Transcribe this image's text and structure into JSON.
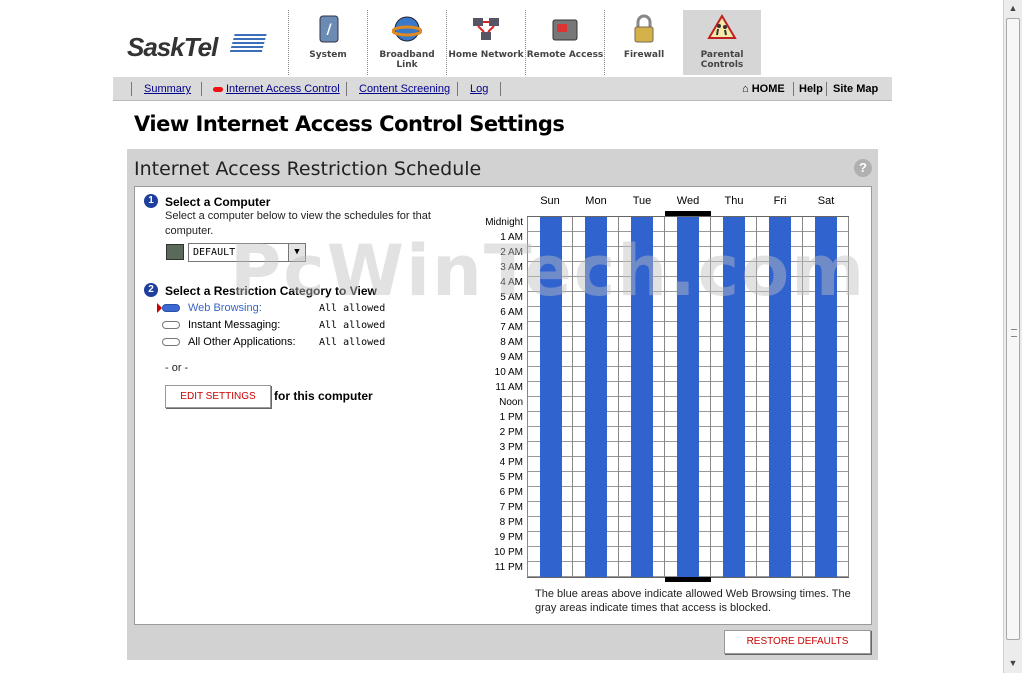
{
  "brand": {
    "logo_text": "SaskTel"
  },
  "nav": [
    {
      "label": "System",
      "icon": "system-icon"
    },
    {
      "label": "Broadband Link",
      "icon": "globe-icon"
    },
    {
      "label": "Home Network",
      "icon": "network-icon"
    },
    {
      "label": "Remote Access",
      "icon": "remote-access-icon"
    },
    {
      "label": "Firewall",
      "icon": "padlock-icon"
    },
    {
      "label": "Parental Controls",
      "icon": "warning-sign-icon",
      "active": true
    }
  ],
  "subnav": {
    "links": [
      "Summary",
      "Internet Access Control",
      "Content Screening",
      "Log"
    ],
    "home": "HOME",
    "help": "Help",
    "sitemap": "Site Map"
  },
  "page_title": "View Internet Access Control Settings",
  "panel": {
    "title": "Internet Access Restriction Schedule",
    "help_glyph": "?",
    "step1": {
      "number": "1",
      "title": "Select a Computer",
      "desc_line1": "Select a computer below to view the schedules for that",
      "desc_line2": "computer.",
      "selected_computer": "DEFAULT"
    },
    "step2": {
      "number": "2",
      "title": "Select a Restriction Category to View",
      "categories": [
        {
          "label": "Web Browsing:",
          "value": "All allowed",
          "selected": true
        },
        {
          "label": "Instant Messaging:",
          "value": "All allowed",
          "selected": false
        },
        {
          "label": "All Other Applications:",
          "value": "All allowed",
          "selected": false
        }
      ]
    },
    "or_text": "- or -",
    "edit_button": "EDIT SETTINGS",
    "edit_suffix": "for this computer",
    "days": [
      "Sun",
      "Mon",
      "Tue",
      "Wed",
      "Thu",
      "Fri",
      "Sat"
    ],
    "current_day": "Wed",
    "hours": [
      "Midnight",
      "1 AM",
      "2 AM",
      "3 AM",
      "4 AM",
      "5 AM",
      "6 AM",
      "7 AM",
      "8 AM",
      "9 AM",
      "10 AM",
      "11 AM",
      "Noon",
      "1 PM",
      "2 PM",
      "3 PM",
      "4 PM",
      "5 PM",
      "6 PM",
      "7 PM",
      "8 PM",
      "9 PM",
      "10 PM",
      "11 PM"
    ],
    "allowed_color": "#3163cf",
    "note": "The blue areas above indicate allowed Web Browsing times. The gray areas indicate times that access is blocked.",
    "restore_button": "RESTORE DEFAULTS"
  },
  "watermark": "PcWinTech.com"
}
